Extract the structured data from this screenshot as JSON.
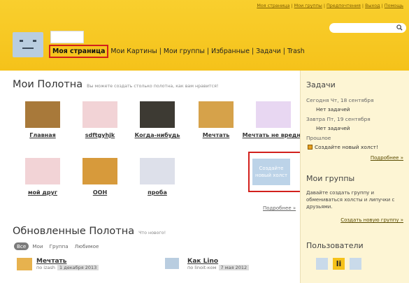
{
  "header": {
    "top_links": [
      "Моя страница",
      "Мои группы",
      "Предпочтения",
      "Выход",
      "Помощь"
    ],
    "search": {
      "icon": "magnifier-icon",
      "placeholder": ""
    },
    "nav": {
      "active": "Моя страница",
      "items": [
        "Мои Картины",
        "Мои группы",
        "Избранные",
        "Задачи",
        "Trash"
      ]
    }
  },
  "my_boards": {
    "title": "Мои Полотна",
    "subtitle": "Вы можете создать столько полотна, как вам нравится!",
    "boards": [
      {
        "label": "Главная",
        "color": "#a8793a"
      },
      {
        "label": "sdftgyhjk",
        "color": "#f2d3d6"
      },
      {
        "label": "Когда-нибудь",
        "color": "#3d3a33"
      },
      {
        "label": "Мечтать",
        "color": "#d6a24a"
      },
      {
        "label": "Мечтать не вредно",
        "color": "#e8d7f2"
      },
      {
        "label": "мой друг",
        "color": "#f2d3d6"
      },
      {
        "label": "OOH",
        "color": "#d79a3b"
      },
      {
        "label": "проба",
        "color": "#dde0ea"
      }
    ],
    "create_tile": "Создайте новый холст",
    "more": "Подробнее »"
  },
  "updated": {
    "title": "Обновленные Полотна",
    "subtitle": "Что нового!",
    "filters": {
      "active": "Все",
      "others": [
        "Мои",
        "Группа",
        "Любимое"
      ]
    },
    "items": [
      {
        "title": "Мечтать",
        "author": "по izash",
        "date": "1 декабря 2013"
      },
      {
        "title": "Как Lino",
        "author": "по linoit-ком",
        "date": "7 мая 2012"
      }
    ]
  },
  "sidebar": {
    "tasks_title": "Задачи",
    "today": "Сегодня Чт, 18 сентября",
    "today_none": "Нет задачей",
    "tomorrow": "Завтра Пт, 19 сентября",
    "tomorrow_none": "Нет задачей",
    "past": "Прошлое",
    "create_canvas": "Создайте новый холст!",
    "tasks_more": "Подробнее »",
    "groups_title": "Мои группы",
    "groups_text": "Давайте создать группу и обмениваться холсты и липучки с друзьями.",
    "create_group": "Создать новую группу »",
    "users_title": "Пользователи",
    "user_icon_glyph": "li",
    "accent_color": "#f5c21a",
    "highlight_color": "#d2201c"
  }
}
